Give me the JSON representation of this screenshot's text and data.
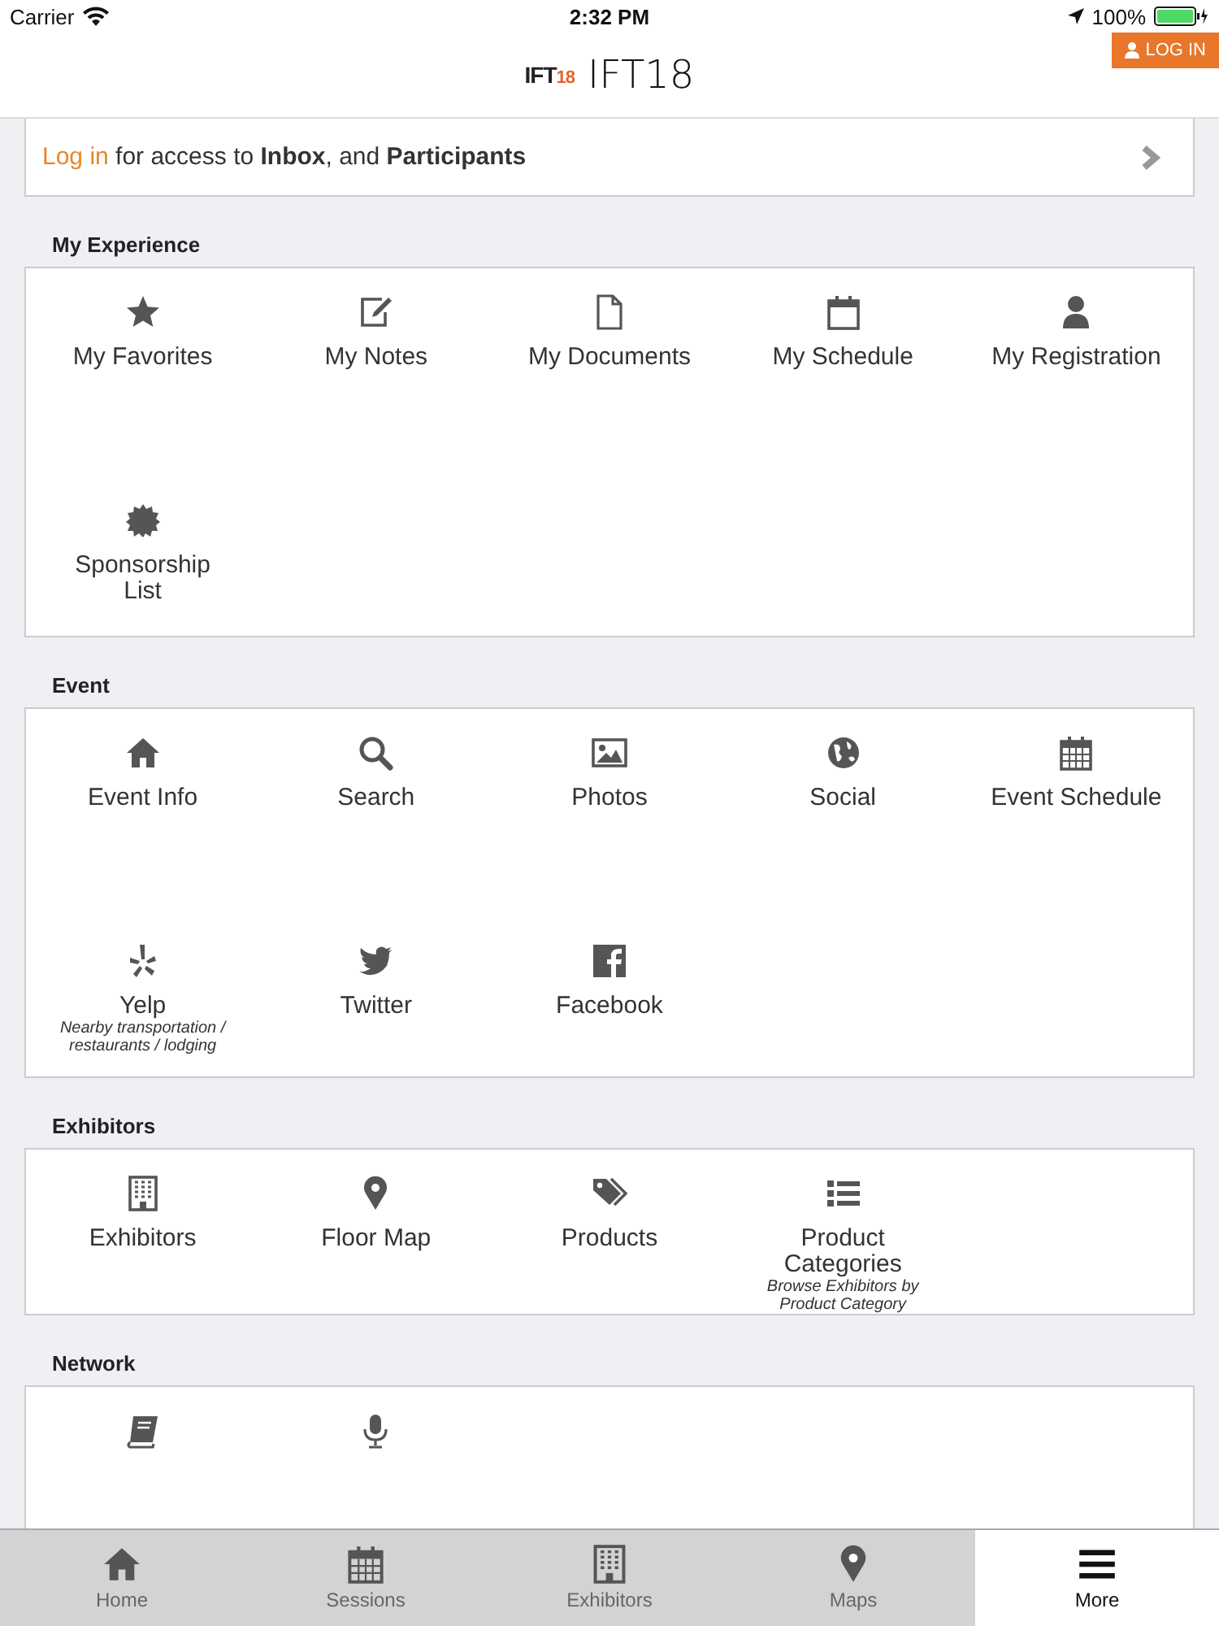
{
  "status_bar": {
    "carrier": "Carrier",
    "time": "2:32 PM",
    "battery": "100%"
  },
  "header": {
    "logo": {
      "text": "IFT",
      "accent": "18"
    },
    "title": "IFT18",
    "login_button": "LOG IN"
  },
  "login_banner": {
    "link": "Log in",
    "text": "for access to **Inbox**, and **Participants**"
  },
  "sections": [
    {
      "title": "My Experience",
      "items": [
        {
          "kind": "star",
          "label": "My Favorites"
        },
        {
          "kind": "note",
          "label": "My Notes"
        },
        {
          "kind": "document",
          "label": "My Documents"
        },
        {
          "kind": "calendar",
          "label": "My Schedule"
        },
        {
          "kind": "person",
          "label": "My Registration"
        },
        {
          "kind": "badge",
          "label": "Sponsorship List"
        }
      ]
    },
    {
      "title": "Event",
      "items": [
        {
          "kind": "home",
          "label": "Event Info"
        },
        {
          "kind": "search",
          "label": "Search"
        },
        {
          "kind": "image",
          "label": "Photos"
        },
        {
          "kind": "globe",
          "label": "Social"
        },
        {
          "kind": "calendar-grid",
          "label": "Event Schedule"
        },
        {
          "kind": "yelp",
          "label": "Yelp",
          "subtitle": "Nearby transportation / restaurants / lodging"
        },
        {
          "kind": "bird",
          "label": "Twitter"
        },
        {
          "kind": "facebook",
          "label": "Facebook"
        }
      ]
    },
    {
      "title": "Exhibitors",
      "items": [
        {
          "kind": "building",
          "label": "Exhibitors"
        },
        {
          "kind": "pin",
          "label": "Floor Map"
        },
        {
          "kind": "tags",
          "label": "Products"
        },
        {
          "kind": "list",
          "label": "Product Categories",
          "subtitle": "Browse Exhibitors by Product Category"
        }
      ]
    },
    {
      "title": "Network",
      "items": [
        {
          "kind": "book"
        },
        {
          "kind": "mic"
        }
      ]
    }
  ],
  "tabs": [
    {
      "kind": "home",
      "label": "Home",
      "selected": false
    },
    {
      "kind": "calendar-grid",
      "label": "Sessions",
      "selected": false
    },
    {
      "kind": "building",
      "label": "Exhibitors",
      "selected": false
    },
    {
      "kind": "pin",
      "label": "Maps",
      "selected": false
    },
    {
      "kind": "menu",
      "label": "More",
      "selected": true
    }
  ]
}
